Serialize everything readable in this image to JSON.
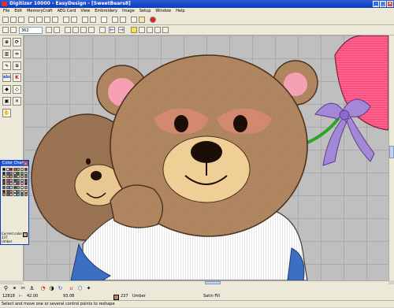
{
  "window": {
    "title": "Digitizer 10000 - EasyDesign - [SweetBears8]",
    "buttons": [
      "_",
      "□",
      "×"
    ]
  },
  "menu": [
    "File",
    "Edit",
    "MemoryCraft",
    "AEG Card",
    "View",
    "Embroidery",
    "Image",
    "Setup",
    "Window",
    "Help"
  ],
  "toolbar": {
    "zoom_value": "362"
  },
  "color_chart": {
    "title": "Color Chart",
    "current_label": "Current color",
    "current_number": "237",
    "current_name": "Umber",
    "colors": [
      "#000000",
      "#ffffff",
      "#c00000",
      "#ff4040",
      "#ff8080",
      "#ffc0c0",
      "#804000",
      "#0000a0",
      "#4040ff",
      "#8080ff",
      "#c0c0ff",
      "#008000",
      "#40c040",
      "#a0e0a0",
      "#ffff00",
      "#ffc000",
      "#ff8000",
      "#a05000",
      "#f0d090",
      "#d7a27a",
      "#808080",
      "#800080",
      "#c040c0",
      "#e0a0e0",
      "#006060",
      "#40a0a0",
      "#a0d0d0",
      "#404040",
      "#603000",
      "#c08040",
      "#f0c0a0",
      "#e0e0e0",
      "#ff0080",
      "#ffa0c0",
      "#402000",
      "#2060c0",
      "#60a0e0",
      "#c0e0ff",
      "#206020",
      "#80c080",
      "#e0f0d0",
      "#a0a0a0",
      "#600000",
      "#a04040",
      "#e08080",
      "#ffe0e0",
      "#8080c0",
      "#d0d0f0",
      "#ffe080",
      "#c0a060",
      "#806040",
      "#e0c0a0",
      "#ffffc0",
      "#40c0ff",
      "#2080a0",
      "#f08040"
    ]
  },
  "status": {
    "stitches": "12818",
    "coord_a": "42.00",
    "coord_b": "93.08",
    "color_number": "237",
    "color_name": "Umber",
    "fill_type": "Satin Fill",
    "hint": "Select and move one or several control points to reshape"
  },
  "colors": {
    "titlebar": "#0a3bb8",
    "canvas": "#bfbfbf",
    "bear": "#b58a63",
    "shirt_trim": "#3b6fc2",
    "balloon": "#ff5f8a",
    "bow": "#a488d8"
  }
}
